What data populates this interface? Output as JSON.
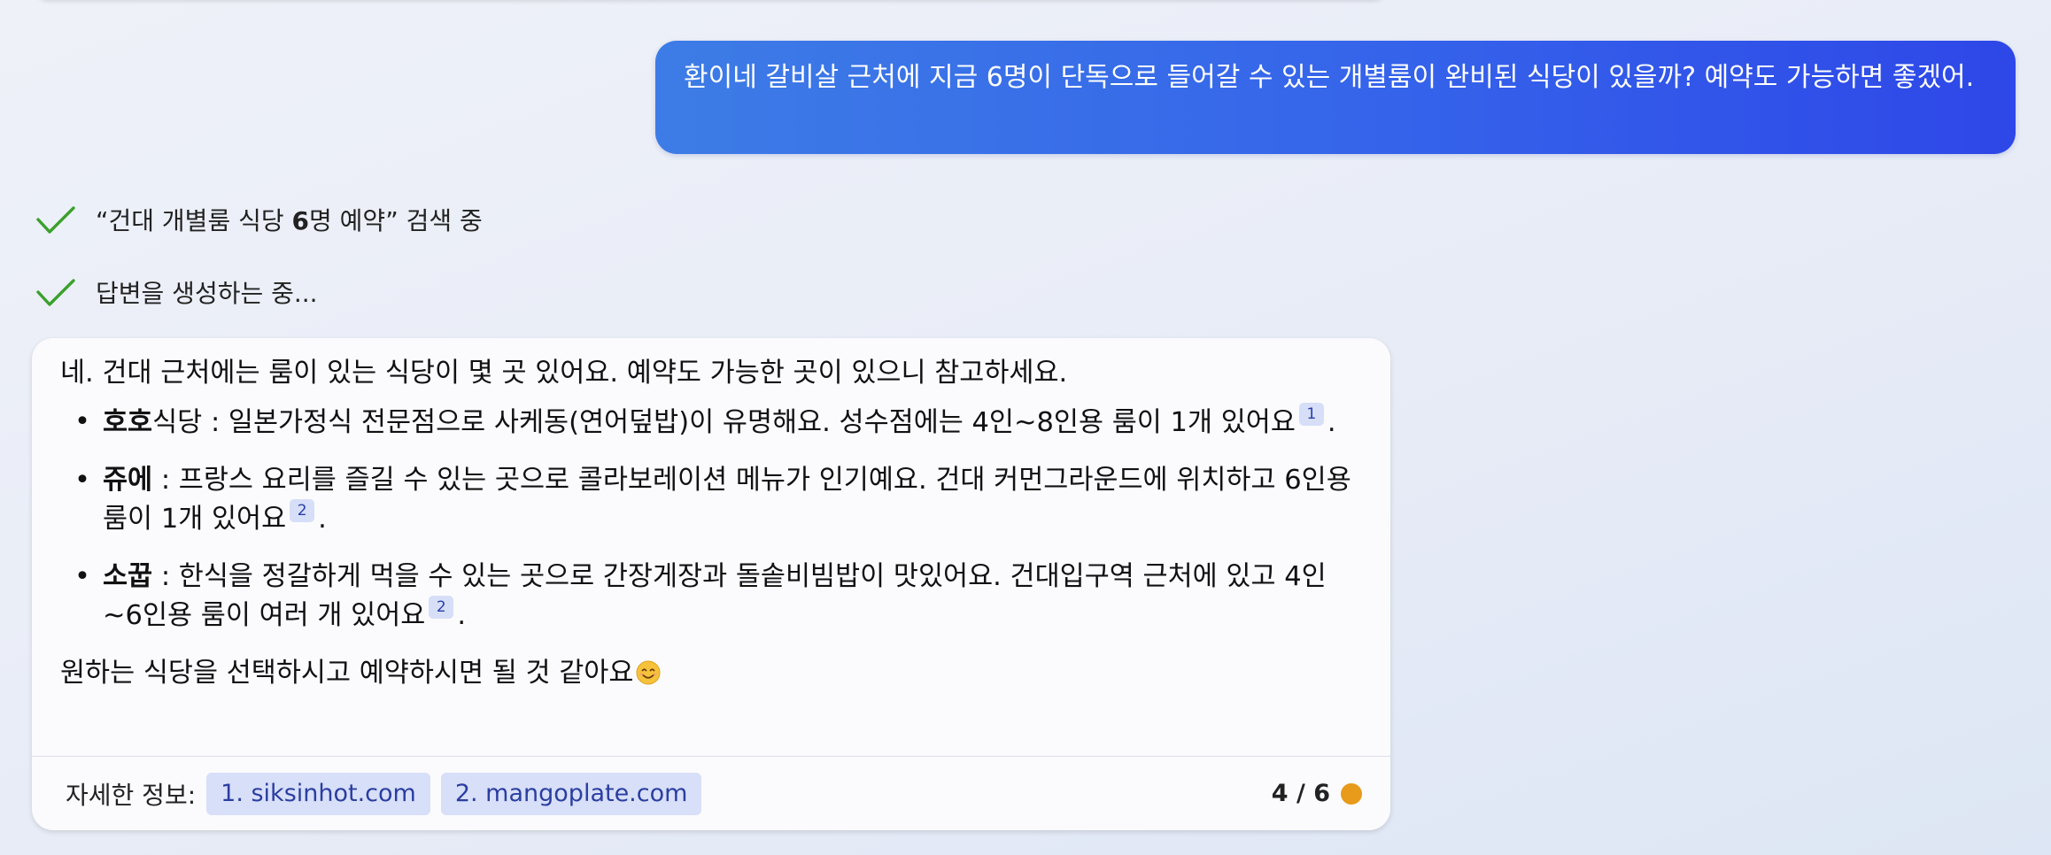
{
  "user_message": {
    "text": "환이네 갈비살 근처에 지금 6명이 단독으로 들어갈 수 있는 개별룸이 완비된 식당이 있을까? 예약도 가능하면 좋겠어."
  },
  "status": {
    "search_prefix": "“건대 개별룸 식당 ",
    "search_bold": "6",
    "search_suffix": "명 예약” 검색 중",
    "generating": "답변을 생성하는 중..."
  },
  "answer": {
    "intro": "네. 건대 근처에는 룸이 있는 식당이 몇 곳 있어요. 예약도 가능한 곳이 있으니 참고하세요.",
    "items": [
      {
        "bullet": "•",
        "name_bold": "호호",
        "name_rest": "식당",
        "desc": " : 일본가정식 전문점으로 사케동(연어덮밥)이 유명해요. 성수점에는 4인~8인용 룸이 1개 있어요",
        "cite": "1",
        "end": "."
      },
      {
        "bullet": "•",
        "name_bold": "쥬에",
        "name_rest": "",
        "desc": " : 프랑스 요리를 즐길 수 있는 곳으로 콜라보레이션 메뉴가 인기예요. 건대 커먼그라운드에 위치하고 6인용 룸이 1개 있어요",
        "cite": "2",
        "end": "."
      },
      {
        "bullet": "•",
        "name_bold": "소꿉",
        "name_rest": "",
        "desc": " : 한식을 정갈하게 먹을 수 있는 곳으로 간장게장과 돌솥비빔밥이 맛있어요. 건대입구역 근처에 있고 4인~6인용 룸이 여러 개 있어요",
        "cite": "2",
        "end": "."
      }
    ],
    "outro": "원하는 식당을 선택하시고 예약하시면 될 것 같아요",
    "outro_emoji": "smiling-face-emoji"
  },
  "footer": {
    "label": "자세한 정보:",
    "sources": [
      "1. siksinhot.com",
      "2. mangoplate.com"
    ],
    "turn_counter": "4 / 6",
    "turn_dot_color": "#e89a1a"
  },
  "colors": {
    "user_bubble_start": "#3d7ce6",
    "user_bubble_end": "#2e47e8",
    "check_green": "#3aa12b",
    "chip_bg": "#d7dff9",
    "chip_text": "#2b3ea0"
  }
}
